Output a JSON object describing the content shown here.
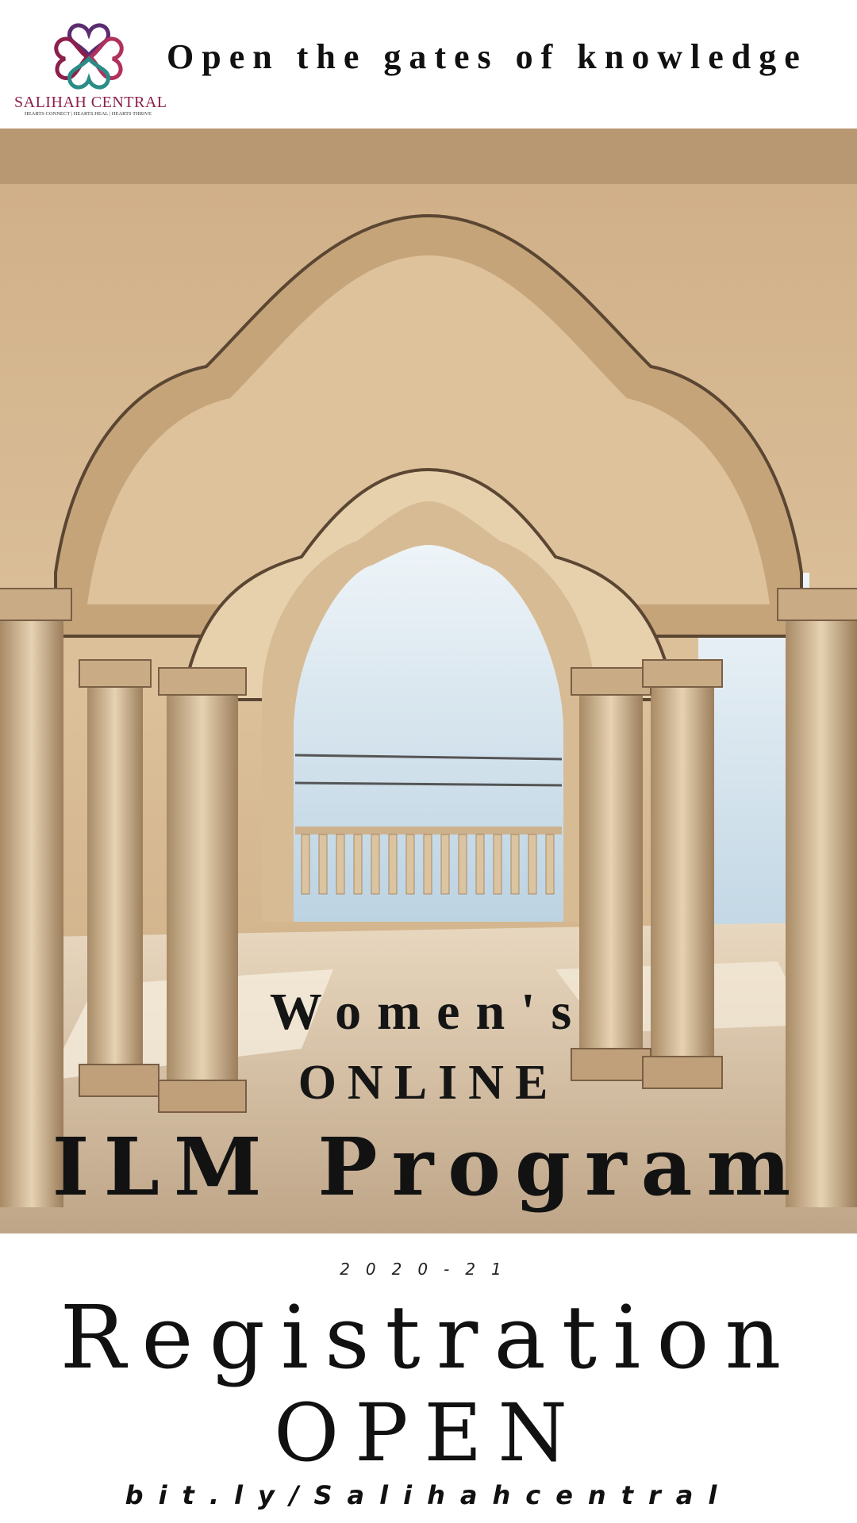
{
  "header": {
    "logo_name": "SALIHAH CENTRAL",
    "logo_tagline": "HEARTS CONNECT | HEARTS HEAL | HEARTS THRIVE",
    "tagline": "Open the gates of knowledge"
  },
  "hero": {
    "line1": "Women's",
    "line2": "ONLINE",
    "line3": "ILM Program"
  },
  "footer": {
    "year": "2020-21",
    "registration": "Registration",
    "open": "OPEN",
    "url": "bit.ly/Salihahcentral"
  },
  "colors": {
    "logo_magenta": "#8c1f4c",
    "logo_teal": "#2a8c86",
    "logo_purple": "#5b2c6f",
    "text": "#111111",
    "stone": "#d9bf98",
    "sky": "#cfe0ea"
  }
}
